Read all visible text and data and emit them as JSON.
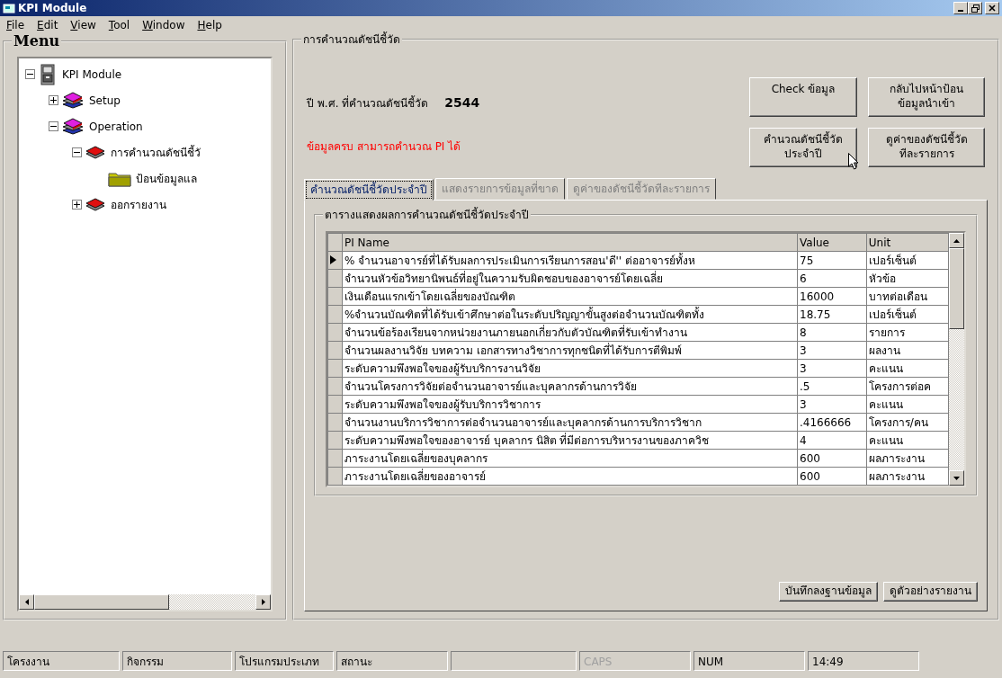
{
  "window": {
    "title": "KPI Module"
  },
  "menu_bar": [
    "File",
    "Edit",
    "View",
    "Tool",
    "Window",
    "Help"
  ],
  "tree_panel": {
    "title": "Menu",
    "tree": [
      {
        "label": "KPI Module",
        "kind": "cabinet",
        "expanded": true,
        "children": [
          {
            "label": "Setup",
            "kind": "books",
            "expanded": false
          },
          {
            "label": "Operation",
            "kind": "books",
            "expanded": true,
            "children": [
              {
                "label": "การคำนวณดัชนีชี้วั",
                "kind": "book",
                "expanded": true,
                "children": [
                  {
                    "label": "ป้อนข้อมูลแล",
                    "kind": "folder"
                  }
                ]
              },
              {
                "label": "ออกรายงาน",
                "kind": "book",
                "expanded": false
              }
            ]
          }
        ]
      }
    ]
  },
  "calc_panel": {
    "title": "การคำนวณดัชนีชี้วัด",
    "year_label": "ปี พ.ศ. ที่คำนวณดัชนีชี้วัด",
    "year": "2544",
    "message": "ข้อมูลครบ สามารถคำนวณ PI ได้",
    "buttons": [
      "Check ข้อมูล",
      "กลับไปหน้าป้อน\nข้อมูลนำเข้า",
      "คำนวณดัชนีชี้วัด\nประจำปี",
      "ดูค่าของดัชนีชี้วัด\nทีละรายการ"
    ],
    "tabs": [
      {
        "label": "คำนวณดัชนีชี้วัดประจำปี",
        "selected": true
      },
      {
        "label": "แสดงรายการข้อมูลที่ขาด",
        "selected": false
      },
      {
        "label": "ดูค่าของดัชนีชี้วัดทีละรายการ",
        "selected": false
      }
    ],
    "result_group": {
      "title": "ตารางแสดงผลการคำนวณดัชนีชี้วัดประจำปี",
      "columns": [
        "PI Name",
        "Value",
        "Unit"
      ],
      "rows": [
        {
          "selected": true,
          "cells": [
            "% จำนวนอาจารย์ที่ได้รับผลการประเมินการเรียนการสอน'ดี'' ต่ออาจารย์ทั้งห",
            "75",
            "เปอร์เซ็นต์"
          ]
        },
        {
          "selected": false,
          "cells": [
            "จำนวนหัวข้อวิทยานิพนธ์ที่อยู่ในความรับผิดชอบของอาจารย์โดยเฉลี่ย",
            "6",
            "หัวข้อ"
          ]
        },
        {
          "selected": false,
          "cells": [
            "เงินเดือนแรกเข้าโดยเฉลี่ยของบัณฑิต",
            "16000",
            "บาทต่อเดือน"
          ]
        },
        {
          "selected": false,
          "cells": [
            "%จำนวนบัณฑิตที่ได้รับเข้าศึกษาต่อในระดับปริญญาขั้นสูงต่อจำนวนบัณฑิตทั้ง",
            "18.75",
            "เปอร์เซ็นต์"
          ]
        },
        {
          "selected": false,
          "cells": [
            "จำนวนข้อร้องเรียนจากหน่วยงานภายนอกเกี่ยวกับตัวบัณฑิตที่รับเข้าทำงาน",
            "8",
            "รายการ"
          ]
        },
        {
          "selected": false,
          "cells": [
            "จำนวนผลงานวิจัย  บทความ เอกสารทางวิชาการทุกชนิดที่ได้รับการตีพิมพ์",
            "3",
            "ผลงาน"
          ]
        },
        {
          "selected": false,
          "cells": [
            "ระดับความพึงพอใจของผู้รับบริการงานวิจัย",
            "3",
            "คะแนน"
          ]
        },
        {
          "selected": false,
          "cells": [
            "จำนวนโครงการวิจัยต่อจำนวนอาจารย์และบุคลากรด้านการวิจัย",
            ".5",
            "โครงการต่อค"
          ]
        },
        {
          "selected": false,
          "cells": [
            "ระดับความพึงพอใจของผู้รับบริการวิชาการ",
            "3",
            "คะแนน"
          ]
        },
        {
          "selected": false,
          "cells": [
            "จำนวนงานบริการวิชาการต่อจำนวนอาจารย์และบุคลากรด้านการบริการวิชาก",
            ".4166666",
            "โครงการ/คน"
          ]
        },
        {
          "selected": false,
          "cells": [
            "ระดับความพึงพอใจของอาจารย์ บุคลากร นิสิต ที่มีต่อการบริหารงานของภาควิช",
            "4",
            "คะแนน"
          ]
        },
        {
          "selected": false,
          "cells": [
            "ภาระงานโดยเฉลี่ยของบุคลากร",
            "600",
            "ผลภาระงาน"
          ]
        },
        {
          "selected": false,
          "cells": [
            "ภาระงานโดยเฉลี่ยของอาจารย์",
            "600",
            "ผลภาระงาน"
          ]
        }
      ]
    },
    "footer_buttons": [
      "บันทึกลงฐานข้อมูล",
      "ดูตัวอย่างรายงาน"
    ]
  },
  "status_bar": {
    "panes": [
      {
        "text": "โครงงาน",
        "enabled": true
      },
      {
        "text": "กิจกรรม",
        "enabled": true
      },
      {
        "text": "โปรแกรมประเภท",
        "enabled": true
      },
      {
        "text": "สถานะ",
        "enabled": true
      },
      {
        "text": "CAPS",
        "enabled": false
      },
      {
        "text": "NUM",
        "enabled": true
      },
      {
        "text": "14:49",
        "enabled": true
      }
    ]
  }
}
